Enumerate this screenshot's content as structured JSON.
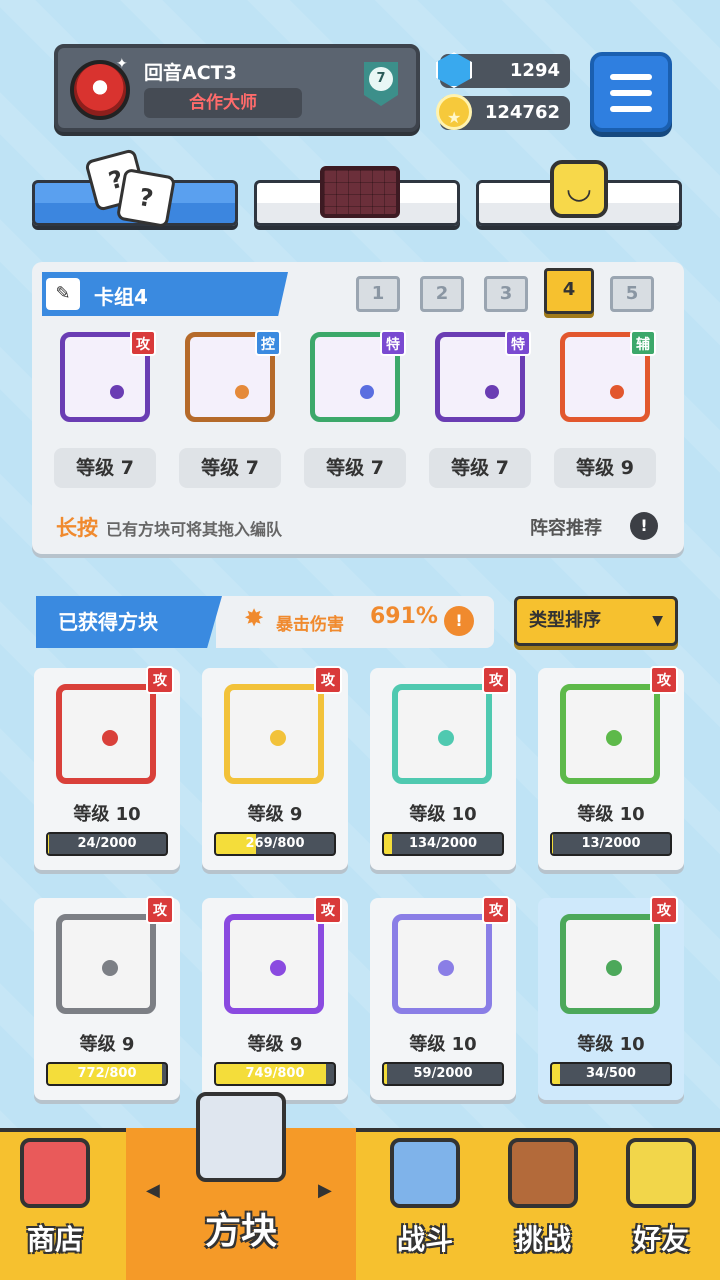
{
  "profile": {
    "name": "回音ACT3",
    "title": "合作大师",
    "level": "7"
  },
  "currency": {
    "gems": "1294",
    "coins": "124762"
  },
  "deck": {
    "name": "卡组4",
    "tabs": [
      "1",
      "2",
      "3",
      "4",
      "5"
    ],
    "active_tab": "4",
    "slots": [
      {
        "badge": "攻",
        "badge_color": "#d93a3a",
        "frame_color": "#6a3db3",
        "dot_color": "#6a3db3",
        "level": "等级 7"
      },
      {
        "badge": "控",
        "badge_color": "#3a8ae0",
        "frame_color": "#b56a2a",
        "dot_color": "#e58a3a",
        "level": "等级 7"
      },
      {
        "badge": "特",
        "badge_color": "#7a4ad1",
        "frame_color": "#3ca86a",
        "dot_color": "#5a6ee0",
        "level": "等级 7"
      },
      {
        "badge": "特",
        "badge_color": "#7a4ad1",
        "frame_color": "#6a3db3",
        "dot_color": "#6a3db3",
        "level": "等级 7"
      },
      {
        "badge": "辅",
        "badge_color": "#3ca86a",
        "frame_color": "#e2572e",
        "dot_color": "#e2572e",
        "level": "等级 9"
      }
    ],
    "hint_key": "长按",
    "hint_text": "已有方块可将其拖入编队",
    "recommend": "阵容推荐"
  },
  "collection": {
    "label": "已获得方块",
    "crit_label": "暴击伤害",
    "crit_value": "691%",
    "sort_label": "类型排序"
  },
  "cards": [
    {
      "badge": "攻",
      "level": "等级 10",
      "progress": "24/2000",
      "fill": 0.012,
      "color": "#d9403a"
    },
    {
      "badge": "攻",
      "level": "等级 9",
      "progress": "269/800",
      "fill": 0.336,
      "color": "#f2c23a"
    },
    {
      "badge": "攻",
      "level": "等级 10",
      "progress": "134/2000",
      "fill": 0.067,
      "color": "#4fc9b0"
    },
    {
      "badge": "攻",
      "level": "等级 10",
      "progress": "13/2000",
      "fill": 0.0065,
      "color": "#5db94a"
    },
    {
      "badge": "攻",
      "level": "等级 9",
      "progress": "772/800",
      "fill": 0.965,
      "color": "#7c7f85"
    },
    {
      "badge": "攻",
      "level": "等级 9",
      "progress": "749/800",
      "fill": 0.936,
      "color": "#8a4ae0"
    },
    {
      "badge": "攻",
      "level": "等级 10",
      "progress": "59/2000",
      "fill": 0.0295,
      "color": "#8a7ee6"
    },
    {
      "badge": "攻",
      "level": "等级 10",
      "progress": "34/500",
      "fill": 0.068,
      "color": "#4ca85a"
    }
  ],
  "nav": {
    "shop": "商店",
    "blocks": "方块",
    "battle": "战斗",
    "challenge": "挑战",
    "friends": "好友"
  }
}
